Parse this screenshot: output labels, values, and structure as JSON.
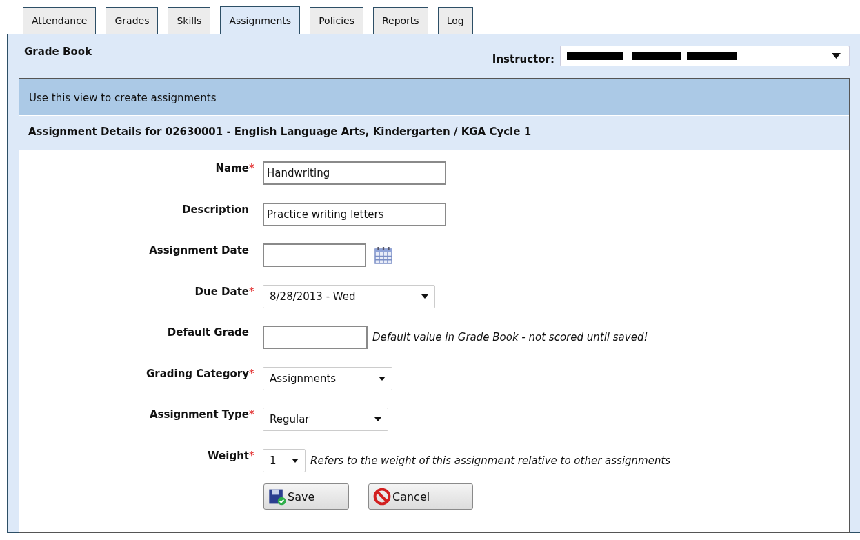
{
  "tabs": [
    {
      "label": "Attendance",
      "selected": false
    },
    {
      "label": "Grades",
      "selected": false
    },
    {
      "label": "Skills",
      "selected": false
    },
    {
      "label": "Assignments",
      "selected": true
    },
    {
      "label": "Policies",
      "selected": false
    },
    {
      "label": "Reports",
      "selected": false
    },
    {
      "label": "Log",
      "selected": false
    }
  ],
  "page_title": "Grade Book",
  "instructor": {
    "label": "Instructor:"
  },
  "info_bar": "Use this view to create assignments",
  "section_title": "Assignment Details for 02630001 - English Language Arts, Kindergarten / KGA Cycle 1",
  "fields": [
    {
      "kind": "text",
      "label": "Name",
      "required_mark": "*",
      "value": "Handwriting"
    },
    {
      "kind": "text",
      "label": "Description",
      "value": "Practice writing letters"
    },
    {
      "kind": "date",
      "label": "Assignment Date"
    },
    {
      "kind": "select",
      "label": "Due Date",
      "required_mark": "*",
      "value": "8/28/2013 - Wed"
    },
    {
      "kind": "text",
      "label": "Default Grade",
      "hint": "Default value in Grade Book - not scored until saved!"
    },
    {
      "kind": "select",
      "label": "Grading Category",
      "required_mark": "*",
      "value": "Assignments"
    },
    {
      "kind": "select",
      "label": "Assignment Type",
      "required_mark": "*",
      "value": "Regular"
    },
    {
      "kind": "select",
      "label": "Weight",
      "required_mark": "*",
      "value": "1",
      "hint": "Refers to the weight of this assignment relative to other assignments"
    }
  ],
  "buttons": [
    {
      "kind": "save",
      "label": "Save"
    },
    {
      "kind": "cancel",
      "label": "Cancel"
    }
  ]
}
